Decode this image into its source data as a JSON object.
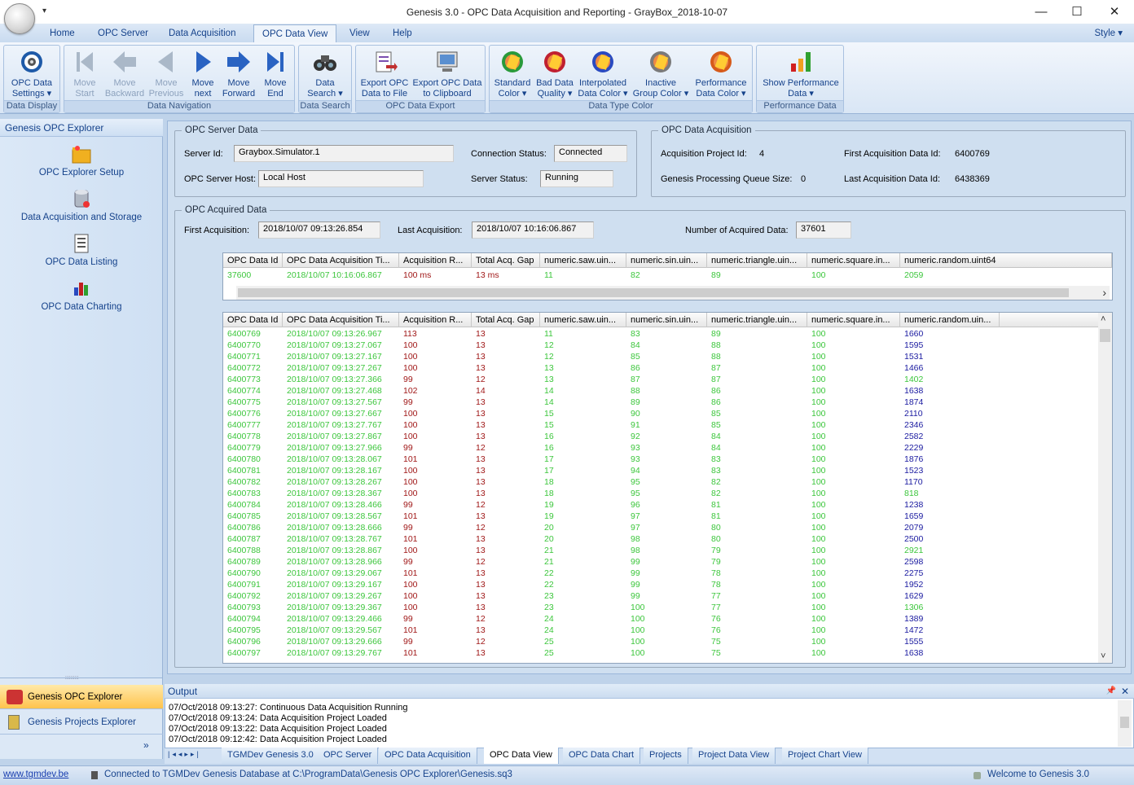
{
  "window": {
    "title": "Genesis 3.0 - OPC Data Acquisition and Reporting - GrayBox_2018-10-07",
    "minimize": "—",
    "maximize": "☐",
    "close": "✕",
    "quick_access": "▾"
  },
  "ribbon_tabs": [
    "Home",
    "OPC Server",
    "Data Acquisition",
    "OPC Data View",
    "View",
    "Help"
  ],
  "style_menu": "Style ▾",
  "ribbon": {
    "groups": [
      "Data Display",
      "Data Navigation",
      "Data Search",
      "OPC Data Export",
      "Data Type Color",
      "Performance Data"
    ],
    "opc_data_settings": [
      "OPC Data",
      "Settings ▾"
    ],
    "move_start": [
      "Move",
      "Start"
    ],
    "move_backward": [
      "Move",
      "Backward"
    ],
    "move_previous": [
      "Move",
      "Previous"
    ],
    "move_next": [
      "Move",
      "next"
    ],
    "move_forward": [
      "Move",
      "Forward"
    ],
    "move_end": [
      "Move",
      "End"
    ],
    "data_search": [
      "Data",
      "Search ▾"
    ],
    "export_file": [
      "Export OPC",
      "Data to File"
    ],
    "export_clip": [
      "Export OPC Data",
      "to Clipboard"
    ],
    "standard_color": [
      "Standard",
      "Color ▾"
    ],
    "bad_quality": [
      "Bad Data",
      "Quality ▾"
    ],
    "interpolated": [
      "Interpolated",
      "Data Color ▾"
    ],
    "inactive": [
      "Inactive",
      "Group Color ▾"
    ],
    "performance_color": [
      "Performance",
      "Data Color ▾"
    ],
    "show_performance": [
      "Show Performance",
      "Data ▾"
    ]
  },
  "explorer": {
    "title": "Genesis OPC Explorer",
    "items": [
      "OPC Explorer Setup",
      "Data Acquisition and Storage",
      "OPC Data Listing",
      "OPC Data Charting"
    ]
  },
  "nav": {
    "explorer": "Genesis OPC Explorer",
    "projects": "Genesis Projects Explorer",
    "more": "»",
    "grip": "::::::::::"
  },
  "server": {
    "legend": "OPC Server Data",
    "server_id_label": "Server Id:",
    "server_id": "Graybox.Simulator.1",
    "host_label": "OPC Server Host:",
    "host": "Local Host",
    "conn_label": "Connection Status:",
    "conn": "Connected",
    "status_label": "Server Status:",
    "status": "Running"
  },
  "acq": {
    "legend": "OPC Data Acquisition",
    "proj_label": "Acquisition Project Id:",
    "proj": "4",
    "queue_label": "Genesis Processing Queue Size:",
    "queue": "0",
    "first_label": "First Acquisition Data Id:",
    "first": "6400769",
    "last_label": "Last Acquisition Data Id:",
    "last": "6438369"
  },
  "acquired": {
    "legend": "OPC Acquired Data",
    "first_label": "First Acquisition:",
    "first": "2018/10/07 09:13:26.854",
    "last_label": "Last Acquisition:",
    "last": "2018/10/07 10:16:06.867",
    "count_label": "Number of Acquired Data:",
    "count": "37601"
  },
  "grid1": {
    "headers": [
      "OPC Data Id",
      "OPC Data Acquisition Ti...",
      "Acquisition R...",
      "Total Acq. Gap",
      "numeric.saw.uin...",
      "numeric.sin.uin...",
      "numeric.triangle.uin...",
      "numeric.square.in...",
      "numeric.random.uint64"
    ],
    "row": [
      "37600",
      "2018/10/07 10:16:06.867",
      "100 ms",
      "13 ms",
      "11",
      "82",
      "89",
      "100",
      "2059"
    ],
    "scroll_right": "›"
  },
  "grid2": {
    "headers": [
      "OPC Data Id",
      "OPC Data Acquisition Ti...",
      "Acquisition R...",
      "Total Acq. Gap",
      "numeric.saw.uin...",
      "numeric.sin.uin...",
      "numeric.triangle.uin...",
      "numeric.square.in...",
      "numeric.random.uin..."
    ],
    "scroll_up": "˄",
    "scroll_down": "˅",
    "rows": [
      [
        "6400769",
        "2018/10/07 09:13:26.967",
        "113",
        "13",
        "11",
        "83",
        "89",
        "100",
        "1660"
      ],
      [
        "6400770",
        "2018/10/07 09:13:27.067",
        "100",
        "13",
        "12",
        "84",
        "88",
        "100",
        "1595"
      ],
      [
        "6400771",
        "2018/10/07 09:13:27.167",
        "100",
        "13",
        "12",
        "85",
        "88",
        "100",
        "1531"
      ],
      [
        "6400772",
        "2018/10/07 09:13:27.267",
        "100",
        "13",
        "13",
        "86",
        "87",
        "100",
        "1466"
      ],
      [
        "6400773",
        "2018/10/07 09:13:27.366",
        "99",
        "12",
        "13",
        "87",
        "87",
        "100",
        "1402"
      ],
      [
        "6400774",
        "2018/10/07 09:13:27.468",
        "102",
        "14",
        "14",
        "88",
        "86",
        "100",
        "1638"
      ],
      [
        "6400775",
        "2018/10/07 09:13:27.567",
        "99",
        "13",
        "14",
        "89",
        "86",
        "100",
        "1874"
      ],
      [
        "6400776",
        "2018/10/07 09:13:27.667",
        "100",
        "13",
        "15",
        "90",
        "85",
        "100",
        "2110"
      ],
      [
        "6400777",
        "2018/10/07 09:13:27.767",
        "100",
        "13",
        "15",
        "91",
        "85",
        "100",
        "2346"
      ],
      [
        "6400778",
        "2018/10/07 09:13:27.867",
        "100",
        "13",
        "16",
        "92",
        "84",
        "100",
        "2582"
      ],
      [
        "6400779",
        "2018/10/07 09:13:27.966",
        "99",
        "12",
        "16",
        "93",
        "84",
        "100",
        "2229"
      ],
      [
        "6400780",
        "2018/10/07 09:13:28.067",
        "101",
        "13",
        "17",
        "93",
        "83",
        "100",
        "1876"
      ],
      [
        "6400781",
        "2018/10/07 09:13:28.167",
        "100",
        "13",
        "17",
        "94",
        "83",
        "100",
        "1523"
      ],
      [
        "6400782",
        "2018/10/07 09:13:28.267",
        "100",
        "13",
        "18",
        "95",
        "82",
        "100",
        "1170"
      ],
      [
        "6400783",
        "2018/10/07 09:13:28.367",
        "100",
        "13",
        "18",
        "95",
        "82",
        "100",
        "818"
      ],
      [
        "6400784",
        "2018/10/07 09:13:28.466",
        "99",
        "12",
        "19",
        "96",
        "81",
        "100",
        "1238"
      ],
      [
        "6400785",
        "2018/10/07 09:13:28.567",
        "101",
        "13",
        "19",
        "97",
        "81",
        "100",
        "1659"
      ],
      [
        "6400786",
        "2018/10/07 09:13:28.666",
        "99",
        "12",
        "20",
        "97",
        "80",
        "100",
        "2079"
      ],
      [
        "6400787",
        "2018/10/07 09:13:28.767",
        "101",
        "13",
        "20",
        "98",
        "80",
        "100",
        "2500"
      ],
      [
        "6400788",
        "2018/10/07 09:13:28.867",
        "100",
        "13",
        "21",
        "98",
        "79",
        "100",
        "2921"
      ],
      [
        "6400789",
        "2018/10/07 09:13:28.966",
        "99",
        "12",
        "21",
        "99",
        "79",
        "100",
        "2598"
      ],
      [
        "6400790",
        "2018/10/07 09:13:29.067",
        "101",
        "13",
        "22",
        "99",
        "78",
        "100",
        "2275"
      ],
      [
        "6400791",
        "2018/10/07 09:13:29.167",
        "100",
        "13",
        "22",
        "99",
        "78",
        "100",
        "1952"
      ],
      [
        "6400792",
        "2018/10/07 09:13:29.267",
        "100",
        "13",
        "23",
        "99",
        "77",
        "100",
        "1629"
      ],
      [
        "6400793",
        "2018/10/07 09:13:29.367",
        "100",
        "13",
        "23",
        "100",
        "77",
        "100",
        "1306"
      ],
      [
        "6400794",
        "2018/10/07 09:13:29.466",
        "99",
        "12",
        "24",
        "100",
        "76",
        "100",
        "1389"
      ],
      [
        "6400795",
        "2018/10/07 09:13:29.567",
        "101",
        "13",
        "24",
        "100",
        "76",
        "100",
        "1472"
      ],
      [
        "6400796",
        "2018/10/07 09:13:29.666",
        "99",
        "12",
        "25",
        "100",
        "75",
        "100",
        "1555"
      ],
      [
        "6400797",
        "2018/10/07 09:13:29.767",
        "101",
        "13",
        "25",
        "100",
        "75",
        "100",
        "1638"
      ]
    ],
    "color_map": {
      "green": [
        "1402",
        "818",
        "2921",
        "1306"
      ]
    }
  },
  "output": {
    "title": "Output",
    "pin": "📌",
    "close": "✕",
    "lines": [
      "07/Oct/2018 09:13:27: Continuous Data Acquisition Running",
      "07/Oct/2018 09:13:24: Data Acquisition Project Loaded",
      "07/Oct/2018 09:13:22: Data Acquisition Project Loaded",
      "07/Oct/2018 09:12:42: Data Acquisition Project Loaded"
    ]
  },
  "doc_tabs": [
    "TGMDev Genesis 3.0",
    "OPC Server",
    "OPC Data Acquisition",
    "OPC Data View",
    "OPC Data Chart",
    "Projects",
    "Project Data View",
    "Project Chart View"
  ],
  "doc_nav": [
    "|◂",
    "◂",
    "▸",
    "▸|"
  ],
  "statusbar": {
    "link": "www.tgmdev.be",
    "message": "Connected to TGMDev Genesis Database at C:\\ProgramData\\Genesis OPC Explorer\\Genesis.sq3",
    "welcome": "Welcome to Genesis 3.0"
  },
  "colors": {
    "green": "#3cc63c",
    "red": "#a01818",
    "blue": "#1a1aa0",
    "accent": "#15428b"
  }
}
